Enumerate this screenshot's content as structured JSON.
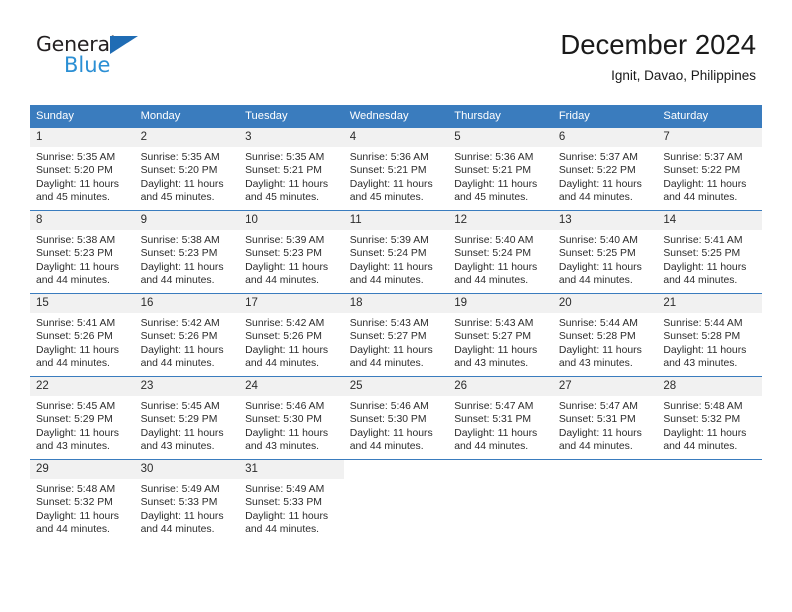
{
  "brand": {
    "name_top": "General",
    "name_bottom": "Blue",
    "triangle_icon": "triangle-icon",
    "color_dark": "#231f20",
    "color_blue": "#2b8fd4",
    "color_triangle": "#1f6cb4"
  },
  "header": {
    "title": "December 2024",
    "subtitle": "Ignit, Davao, Philippines"
  },
  "colors": {
    "header_row": "#3a7cbe",
    "daynum_band": "#f1f1f1",
    "text": "#2c2c2c",
    "page_background": "#ffffff"
  },
  "weekdays": [
    "Sunday",
    "Monday",
    "Tuesday",
    "Wednesday",
    "Thursday",
    "Friday",
    "Saturday"
  ],
  "labels": {
    "sunrise_prefix": "Sunrise:",
    "sunset_prefix": "Sunset:",
    "daylight_prefix": "Daylight:"
  },
  "weeks": [
    [
      {
        "day": "1",
        "sunrise": "Sunrise: 5:35 AM",
        "sunset": "Sunset: 5:20 PM",
        "daylight1": "Daylight: 11 hours",
        "daylight2": "and 45 minutes."
      },
      {
        "day": "2",
        "sunrise": "Sunrise: 5:35 AM",
        "sunset": "Sunset: 5:20 PM",
        "daylight1": "Daylight: 11 hours",
        "daylight2": "and 45 minutes."
      },
      {
        "day": "3",
        "sunrise": "Sunrise: 5:35 AM",
        "sunset": "Sunset: 5:21 PM",
        "daylight1": "Daylight: 11 hours",
        "daylight2": "and 45 minutes."
      },
      {
        "day": "4",
        "sunrise": "Sunrise: 5:36 AM",
        "sunset": "Sunset: 5:21 PM",
        "daylight1": "Daylight: 11 hours",
        "daylight2": "and 45 minutes."
      },
      {
        "day": "5",
        "sunrise": "Sunrise: 5:36 AM",
        "sunset": "Sunset: 5:21 PM",
        "daylight1": "Daylight: 11 hours",
        "daylight2": "and 45 minutes."
      },
      {
        "day": "6",
        "sunrise": "Sunrise: 5:37 AM",
        "sunset": "Sunset: 5:22 PM",
        "daylight1": "Daylight: 11 hours",
        "daylight2": "and 44 minutes."
      },
      {
        "day": "7",
        "sunrise": "Sunrise: 5:37 AM",
        "sunset": "Sunset: 5:22 PM",
        "daylight1": "Daylight: 11 hours",
        "daylight2": "and 44 minutes."
      }
    ],
    [
      {
        "day": "8",
        "sunrise": "Sunrise: 5:38 AM",
        "sunset": "Sunset: 5:23 PM",
        "daylight1": "Daylight: 11 hours",
        "daylight2": "and 44 minutes."
      },
      {
        "day": "9",
        "sunrise": "Sunrise: 5:38 AM",
        "sunset": "Sunset: 5:23 PM",
        "daylight1": "Daylight: 11 hours",
        "daylight2": "and 44 minutes."
      },
      {
        "day": "10",
        "sunrise": "Sunrise: 5:39 AM",
        "sunset": "Sunset: 5:23 PM",
        "daylight1": "Daylight: 11 hours",
        "daylight2": "and 44 minutes."
      },
      {
        "day": "11",
        "sunrise": "Sunrise: 5:39 AM",
        "sunset": "Sunset: 5:24 PM",
        "daylight1": "Daylight: 11 hours",
        "daylight2": "and 44 minutes."
      },
      {
        "day": "12",
        "sunrise": "Sunrise: 5:40 AM",
        "sunset": "Sunset: 5:24 PM",
        "daylight1": "Daylight: 11 hours",
        "daylight2": "and 44 minutes."
      },
      {
        "day": "13",
        "sunrise": "Sunrise: 5:40 AM",
        "sunset": "Sunset: 5:25 PM",
        "daylight1": "Daylight: 11 hours",
        "daylight2": "and 44 minutes."
      },
      {
        "day": "14",
        "sunrise": "Sunrise: 5:41 AM",
        "sunset": "Sunset: 5:25 PM",
        "daylight1": "Daylight: 11 hours",
        "daylight2": "and 44 minutes."
      }
    ],
    [
      {
        "day": "15",
        "sunrise": "Sunrise: 5:41 AM",
        "sunset": "Sunset: 5:26 PM",
        "daylight1": "Daylight: 11 hours",
        "daylight2": "and 44 minutes."
      },
      {
        "day": "16",
        "sunrise": "Sunrise: 5:42 AM",
        "sunset": "Sunset: 5:26 PM",
        "daylight1": "Daylight: 11 hours",
        "daylight2": "and 44 minutes."
      },
      {
        "day": "17",
        "sunrise": "Sunrise: 5:42 AM",
        "sunset": "Sunset: 5:26 PM",
        "daylight1": "Daylight: 11 hours",
        "daylight2": "and 44 minutes."
      },
      {
        "day": "18",
        "sunrise": "Sunrise: 5:43 AM",
        "sunset": "Sunset: 5:27 PM",
        "daylight1": "Daylight: 11 hours",
        "daylight2": "and 44 minutes."
      },
      {
        "day": "19",
        "sunrise": "Sunrise: 5:43 AM",
        "sunset": "Sunset: 5:27 PM",
        "daylight1": "Daylight: 11 hours",
        "daylight2": "and 43 minutes."
      },
      {
        "day": "20",
        "sunrise": "Sunrise: 5:44 AM",
        "sunset": "Sunset: 5:28 PM",
        "daylight1": "Daylight: 11 hours",
        "daylight2": "and 43 minutes."
      },
      {
        "day": "21",
        "sunrise": "Sunrise: 5:44 AM",
        "sunset": "Sunset: 5:28 PM",
        "daylight1": "Daylight: 11 hours",
        "daylight2": "and 43 minutes."
      }
    ],
    [
      {
        "day": "22",
        "sunrise": "Sunrise: 5:45 AM",
        "sunset": "Sunset: 5:29 PM",
        "daylight1": "Daylight: 11 hours",
        "daylight2": "and 43 minutes."
      },
      {
        "day": "23",
        "sunrise": "Sunrise: 5:45 AM",
        "sunset": "Sunset: 5:29 PM",
        "daylight1": "Daylight: 11 hours",
        "daylight2": "and 43 minutes."
      },
      {
        "day": "24",
        "sunrise": "Sunrise: 5:46 AM",
        "sunset": "Sunset: 5:30 PM",
        "daylight1": "Daylight: 11 hours",
        "daylight2": "and 43 minutes."
      },
      {
        "day": "25",
        "sunrise": "Sunrise: 5:46 AM",
        "sunset": "Sunset: 5:30 PM",
        "daylight1": "Daylight: 11 hours",
        "daylight2": "and 44 minutes."
      },
      {
        "day": "26",
        "sunrise": "Sunrise: 5:47 AM",
        "sunset": "Sunset: 5:31 PM",
        "daylight1": "Daylight: 11 hours",
        "daylight2": "and 44 minutes."
      },
      {
        "day": "27",
        "sunrise": "Sunrise: 5:47 AM",
        "sunset": "Sunset: 5:31 PM",
        "daylight1": "Daylight: 11 hours",
        "daylight2": "and 44 minutes."
      },
      {
        "day": "28",
        "sunrise": "Sunrise: 5:48 AM",
        "sunset": "Sunset: 5:32 PM",
        "daylight1": "Daylight: 11 hours",
        "daylight2": "and 44 minutes."
      }
    ],
    [
      {
        "day": "29",
        "sunrise": "Sunrise: 5:48 AM",
        "sunset": "Sunset: 5:32 PM",
        "daylight1": "Daylight: 11 hours",
        "daylight2": "and 44 minutes."
      },
      {
        "day": "30",
        "sunrise": "Sunrise: 5:49 AM",
        "sunset": "Sunset: 5:33 PM",
        "daylight1": "Daylight: 11 hours",
        "daylight2": "and 44 minutes."
      },
      {
        "day": "31",
        "sunrise": "Sunrise: 5:49 AM",
        "sunset": "Sunset: 5:33 PM",
        "daylight1": "Daylight: 11 hours",
        "daylight2": "and 44 minutes."
      },
      null,
      null,
      null,
      null
    ]
  ]
}
